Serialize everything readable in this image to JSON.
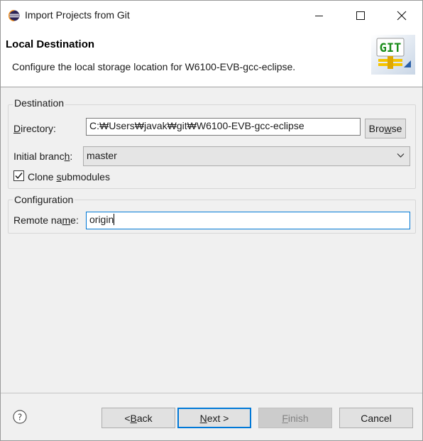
{
  "window": {
    "title": "Import Projects from Git",
    "icon": "eclipse-icon",
    "controls": [
      "minimize-icon",
      "maximize-icon",
      "close-icon"
    ]
  },
  "banner": {
    "title": "Local Destination",
    "description": "Configure the local storage location for W6100-EVB-gcc-eclipse.",
    "logo_text": "GIT"
  },
  "destination": {
    "group_label": "Destination",
    "directory": {
      "label_pre": "",
      "label_mnemonic": "D",
      "label_post": "irectory:",
      "value": "C:₩Users₩javak₩git₩W6100-EVB-gcc-eclipse"
    },
    "browse": {
      "pre": "Bro",
      "mnemonic": "w",
      "post": "se"
    },
    "branch": {
      "label_pre": "Initial branc",
      "label_mnemonic": "h",
      "label_post": ":",
      "value": "master"
    },
    "clone": {
      "checked": true,
      "label_pre": "Clone ",
      "label_mnemonic": "s",
      "label_post": "ubmodules"
    }
  },
  "configuration": {
    "group_label": "Configuration",
    "remote": {
      "label_pre": "Remote na",
      "label_mnemonic": "m",
      "label_post": "e:",
      "value": "origin"
    }
  },
  "buttons": {
    "back": {
      "pre": "< ",
      "mnemonic": "B",
      "post": "ack"
    },
    "next": {
      "pre": "",
      "mnemonic": "N",
      "post": "ext >"
    },
    "finish": {
      "pre": "",
      "mnemonic": "F",
      "post": "inish"
    },
    "cancel": "Cancel"
  },
  "colors": {
    "accent": "#0078d7",
    "dialog_bg": "#f0f0f0",
    "git_logo_green": "#1c8d1c",
    "git_logo_yellow": "#f5c400"
  }
}
